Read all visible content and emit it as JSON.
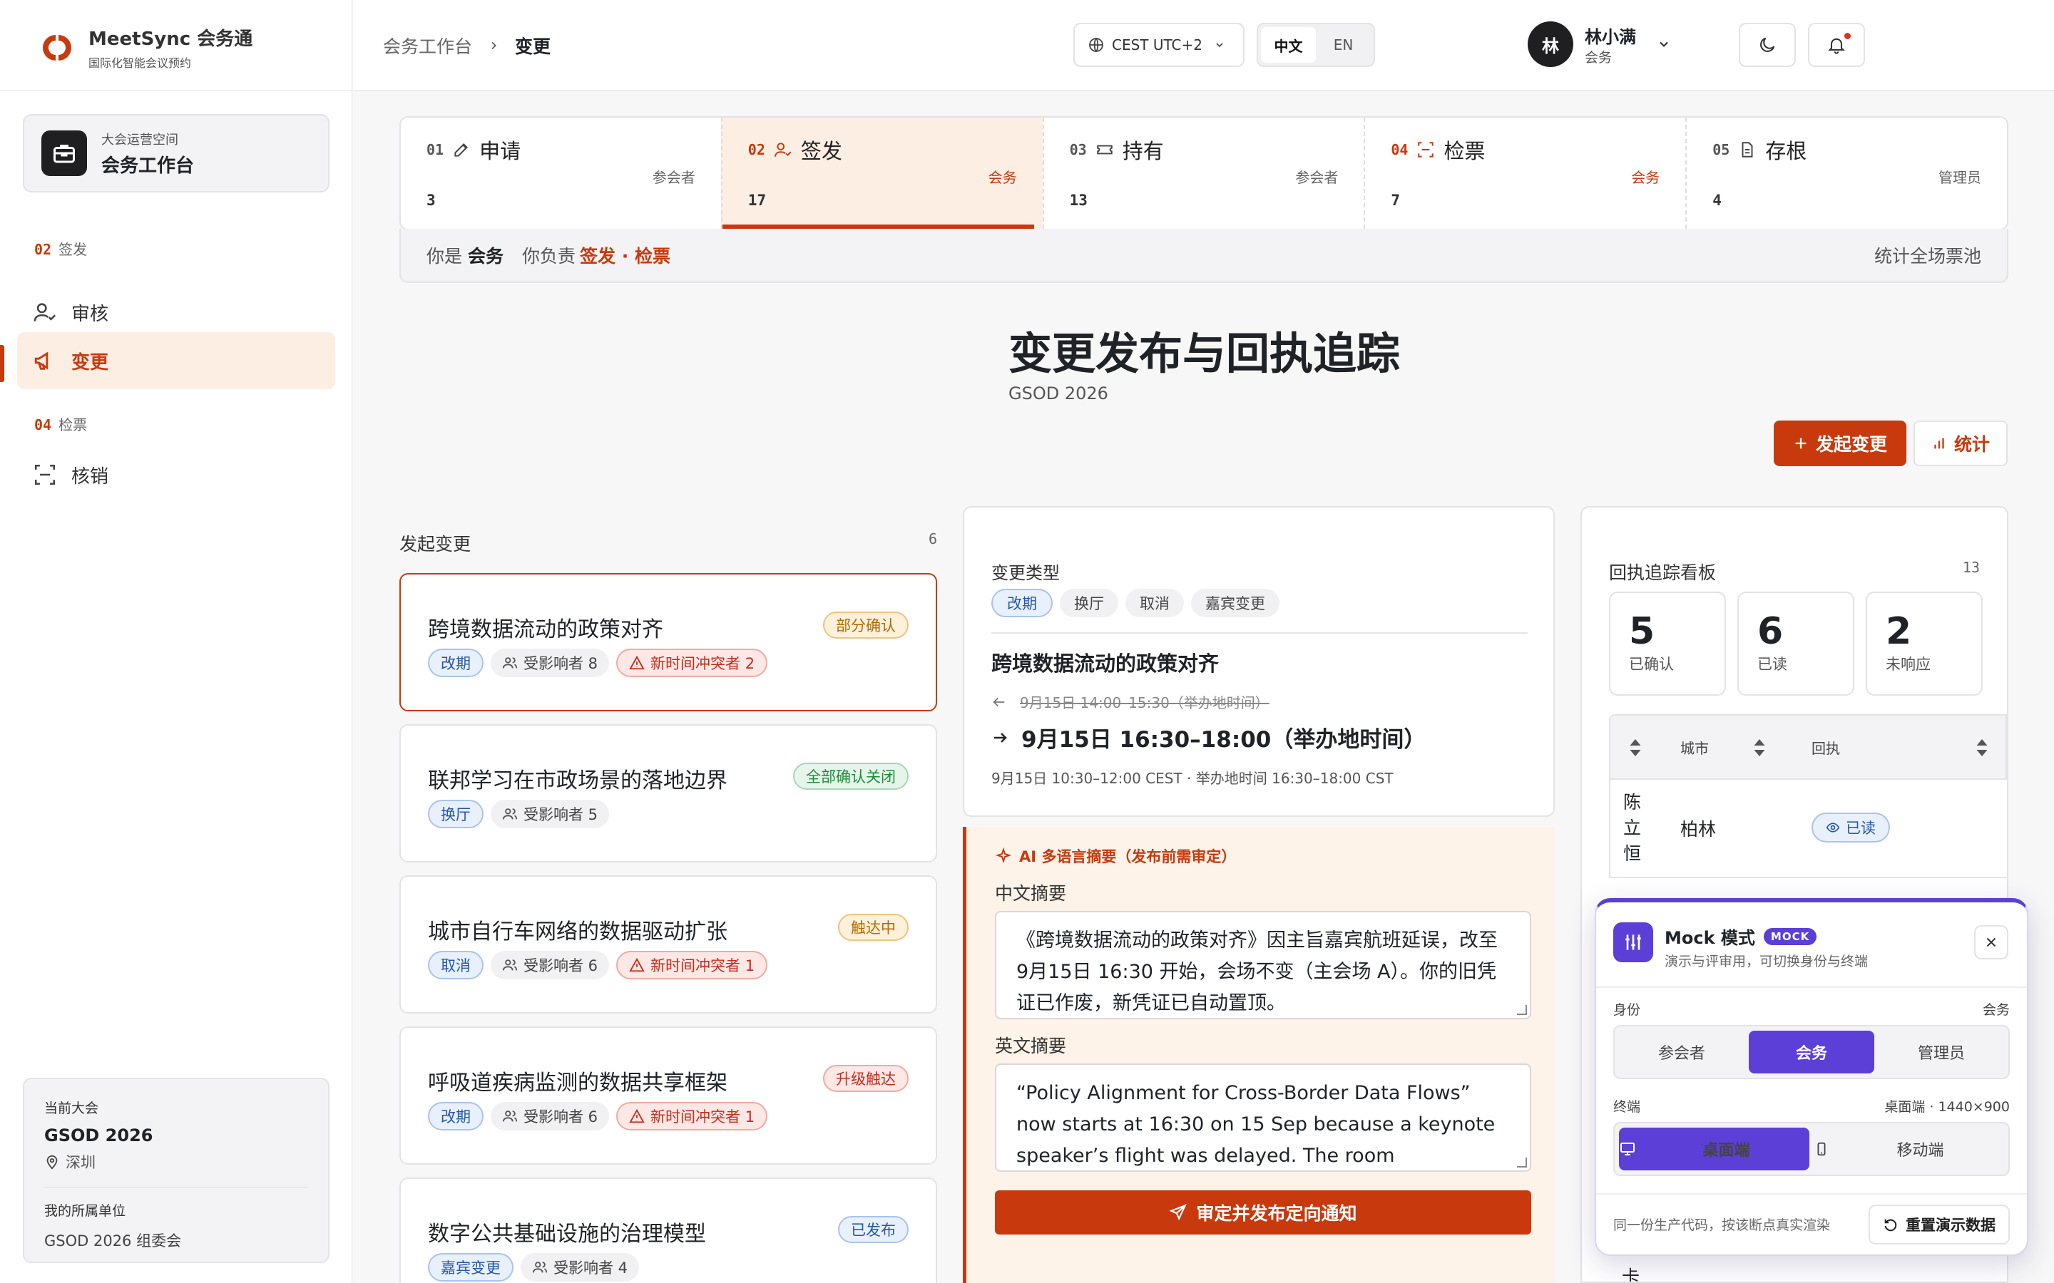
{
  "brand": {
    "name": "MeetSync 会务通",
    "tagline": "国际化智能会议预约"
  },
  "workspace": {
    "label": "大会运营空间",
    "title": "会务工作台"
  },
  "sidebar": {
    "sections": [
      {
        "num": "02",
        "label": "签发"
      },
      {
        "num": "04",
        "label": "检票"
      }
    ],
    "items": [
      {
        "label": "审核",
        "icon": "user-check-icon",
        "active": false
      },
      {
        "label": "变更",
        "icon": "megaphone-icon",
        "active": true
      },
      {
        "label": "核销",
        "icon": "scan-icon",
        "active": false
      }
    ],
    "current": {
      "label": "当前大会",
      "name": "GSOD 2026",
      "location": "深圳",
      "unit_label": "我的所属单位",
      "unit": "GSOD 2026 组委会"
    }
  },
  "header": {
    "breadcrumb": [
      "会务工作台",
      "变更"
    ],
    "timezone": "CEST UTC+2",
    "lang": {
      "zh": "中文",
      "en": "EN",
      "selected": "zh"
    },
    "user": {
      "initial": "林",
      "name": "林小满",
      "role": "会务"
    }
  },
  "steps": [
    {
      "num": "01",
      "name": "申请",
      "role": "参会者",
      "count": "3",
      "icon": "pencil-icon"
    },
    {
      "num": "02",
      "name": "签发",
      "role": "会务",
      "count": "17",
      "icon": "user-check-icon",
      "active": true
    },
    {
      "num": "03",
      "name": "持有",
      "role": "参会者",
      "count": "13",
      "icon": "ticket-icon"
    },
    {
      "num": "04",
      "name": "检票",
      "role": "会务",
      "count": "7",
      "icon": "scan-icon"
    },
    {
      "num": "05",
      "name": "存根",
      "role": "管理员",
      "count": "4",
      "icon": "file-icon"
    }
  ],
  "responsibility": {
    "you_are": "你是",
    "role": "会务",
    "you_handle": "你负责",
    "duties": "签发 · 检票",
    "stats_link": "统计全场票池"
  },
  "page": {
    "title": "变更发布与回执追踪",
    "subtitle": "GSOD 2026",
    "primary_button": "发起变更",
    "secondary_button": "统计"
  },
  "changes": {
    "heading": "发起变更",
    "count": "6",
    "items": [
      {
        "title": "跨境数据流动的政策对齐",
        "status": "部分确认",
        "status_color": "amber",
        "type": "改期",
        "affected": "受影响者 8",
        "conflict": "新时间冲突者 2"
      },
      {
        "title": "联邦学习在市政场景的落地边界",
        "status": "全部确认关闭",
        "status_color": "green",
        "type": "换厅",
        "affected": "受影响者 5",
        "conflict": ""
      },
      {
        "title": "城市自行车网络的数据驱动扩张",
        "status": "触达中",
        "status_color": "amber",
        "type": "取消",
        "affected": "受影响者 6",
        "conflict": "新时间冲突者 1"
      },
      {
        "title": "呼吸道疾病监测的数据共享框架",
        "status": "升级触达",
        "status_color": "red",
        "type": "改期",
        "affected": "受影响者 6",
        "conflict": "新时间冲突者 1"
      },
      {
        "title": "数字公共基础设施的治理模型",
        "status": "已发布",
        "status_color": "blue",
        "type": "嘉宾变更",
        "affected": "受影响者 4",
        "conflict": ""
      }
    ]
  },
  "detail": {
    "type_label": "变更类型",
    "types": [
      "改期",
      "换厅",
      "取消",
      "嘉宾变更"
    ],
    "selected_type": "改期",
    "title": "跨境数据流动的政策对齐",
    "old_time": "9月15日 14:00–15:30（举办地时间）",
    "new_time": "9月15日 16:30–18:00（举办地时间）",
    "tz_note": "9月15日 10:30–12:00 CEST · 举办地时间 16:30–18:00 CST"
  },
  "ai": {
    "heading": "AI 多语言摘要（发布前需审定）",
    "zh_label": "中文摘要",
    "zh_text": "《跨境数据流动的政策对齐》因主旨嘉宾航班延误，改至 9月15日 16:30 开始，会场不变（主会场 A）。你的旧凭证已作废，新凭证已自动置顶。",
    "en_label": "英文摘要",
    "en_text": "“Policy Alignment for Cross-Border Data Flows” now starts at 16:30 on 15 Sep because a keynote speaker’s flight was delayed. The room",
    "send_button": "审定并发布定向通知"
  },
  "board": {
    "heading": "回执追踪看板",
    "count": "13",
    "stats": [
      {
        "value": "5",
        "label": "已确认"
      },
      {
        "value": "6",
        "label": "已读"
      },
      {
        "value": "2",
        "label": "未响应"
      }
    ],
    "columns": [
      "城市",
      "回执"
    ],
    "rows": [
      {
        "name": "陈立恒",
        "city": "柏林",
        "receipt": "已读"
      }
    ],
    "partial_next": "卡"
  },
  "mock": {
    "title": "Mock 模式",
    "badge": "MOCK",
    "subtitle": "演示与评审用，可切换身份与终端",
    "identity_label": "身份",
    "identity_value": "会务",
    "identities": [
      "参会者",
      "会务",
      "管理员"
    ],
    "identity_selected": "会务",
    "terminal_label": "终端",
    "terminal_value": "桌面端 · 1440×900",
    "terminals": [
      "桌面端",
      "移动端"
    ],
    "terminal_selected": "桌面端",
    "footer": "同一份生产代码，按该断点真实渲染",
    "reset_button": "重置演示数据"
  },
  "colors": {
    "accent": "#c8390d",
    "mock_accent": "#5b3fd6",
    "active_bg": "#fdeee4"
  }
}
